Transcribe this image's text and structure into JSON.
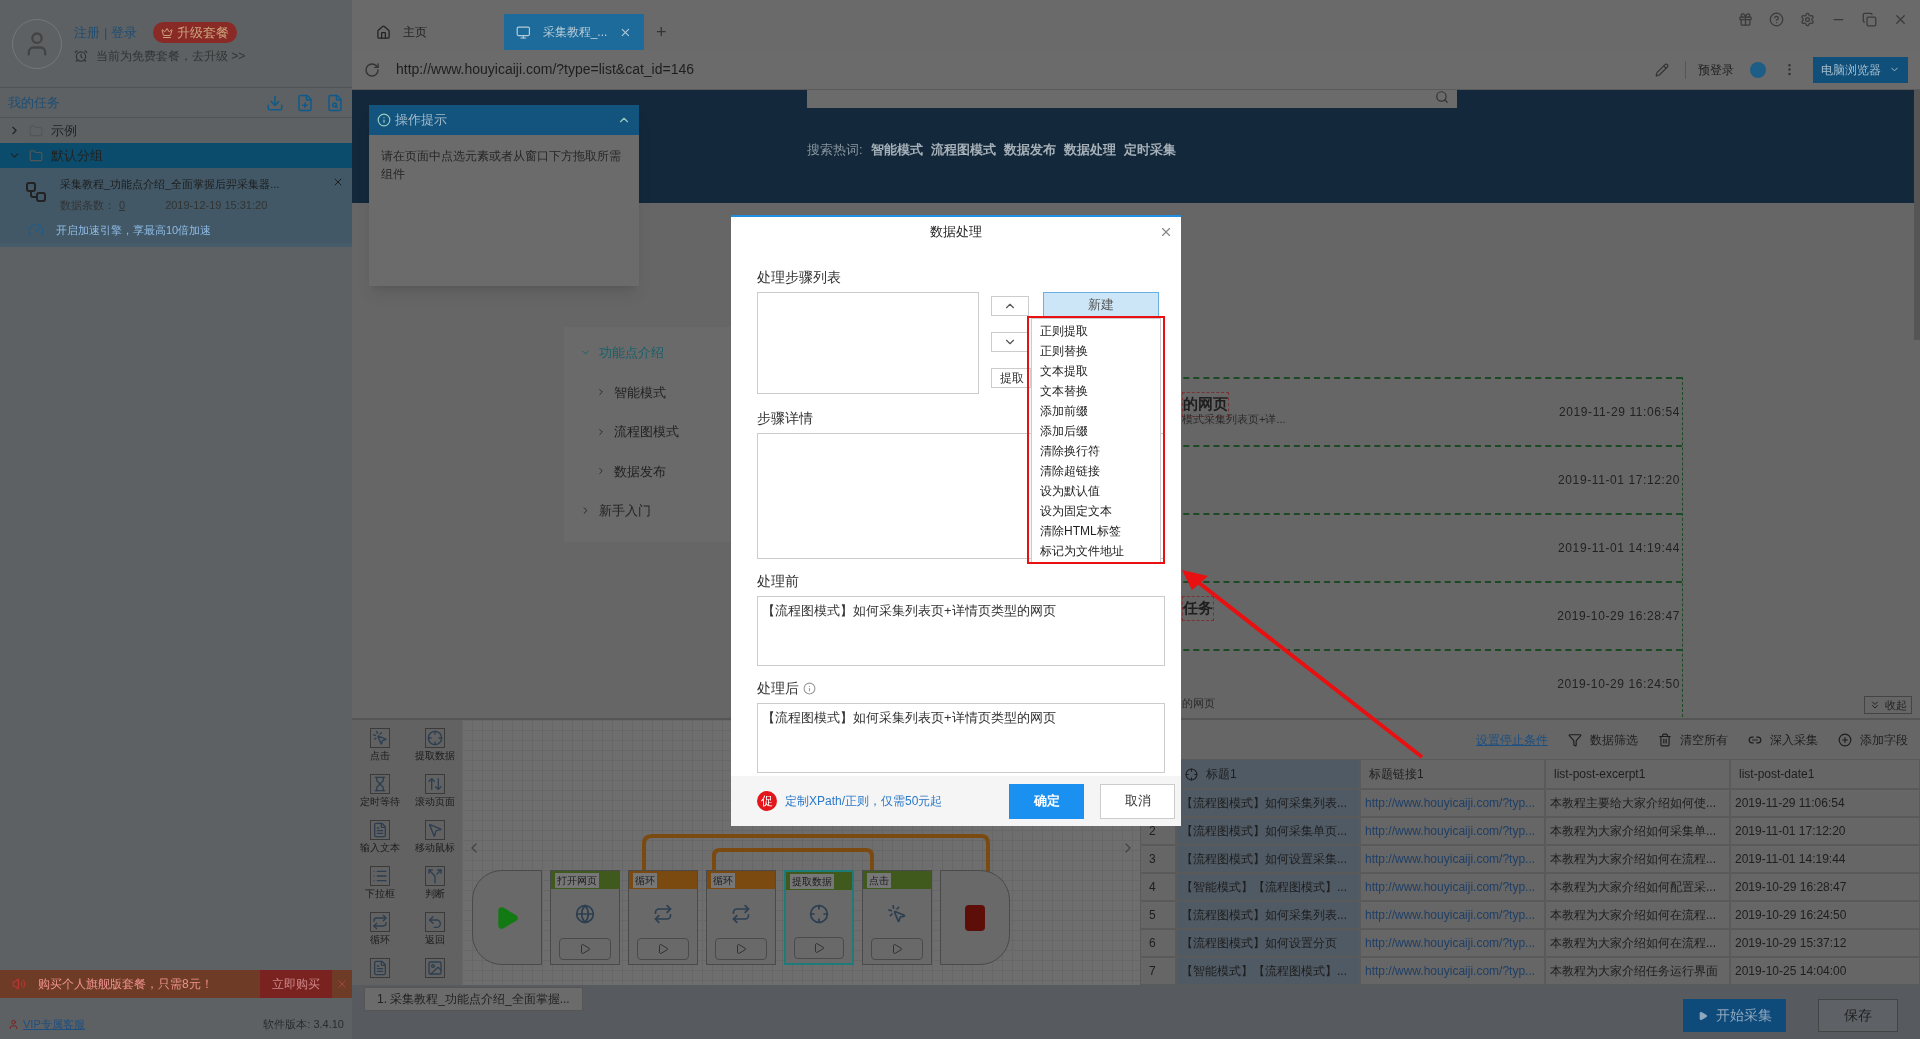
{
  "sidebar": {
    "account_links": [
      "注册",
      "登录"
    ],
    "link_separator": "|",
    "upgrade_badge": "升级套餐",
    "plan_notice": "当前为免费套餐，去升级 >>",
    "tasks_title": "我的任务",
    "groups": [
      {
        "label": "示例",
        "expanded": false,
        "selected": false
      },
      {
        "label": "默认分组",
        "expanded": true,
        "selected": true,
        "tasks": [
          {
            "name": "采集教程_功能点介绍_全面掌握后羿采集器...",
            "count_label": "数据条数：",
            "count": "0",
            "time": "2019-12-19 15:31:20"
          }
        ]
      }
    ],
    "accelerate_link": "开启加速引擎，享最高10倍加速",
    "promo": {
      "text": "购买个人旗舰版套餐，只需8元！",
      "button": "立即购买"
    },
    "vip_link": "VIP专属客服",
    "version": "软件版本: 3.4.10"
  },
  "browser": {
    "tabs": [
      {
        "kind": "home",
        "label": "主页",
        "selected": false
      },
      {
        "kind": "page",
        "label": "采集教程_...",
        "selected": true
      }
    ],
    "new_tab": "+",
    "url": "http://www.houyicaiji.com/?type=list&cat_id=146",
    "prelogin": "预登录",
    "browser_mode": "电脑浏览器"
  },
  "webpage": {
    "hot_label": "搜索热词:",
    "hot_words": [
      "智能模式",
      "流程图模式",
      "数据发布",
      "数据处理",
      "定时采集"
    ],
    "nav": [
      {
        "label": "功能点介绍",
        "expanded": true,
        "selected": true,
        "children": [
          {
            "label": "智能模式"
          },
          {
            "label": "流程图模式"
          },
          {
            "label": "数据发布"
          }
        ]
      },
      {
        "label": "新手入门",
        "expanded": false,
        "selected": false
      }
    ],
    "list_items": [
      {
        "title": "的网页",
        "excerpt": "模式采集列表页+详...",
        "date": "2019-11-29 11:06:54"
      },
      {
        "date": "2019-11-01 17:12:20"
      },
      {
        "date": "2019-11-01 14:19:44"
      },
      {
        "title": "任务",
        "date": "2019-10-29 16:28:47"
      },
      {
        "excerpt": "的网页",
        "date": "2019-10-29 16:24:50"
      }
    ],
    "collapse_button": "收起"
  },
  "tips": {
    "title": "操作提示",
    "body": "请在页面中点选元素或者从窗口下方拖取所需组件"
  },
  "dialog": {
    "title": "数据处理",
    "steps_label": "处理步骤列表",
    "new_button": "新建",
    "extract_button": "提取",
    "menu": [
      "正则提取",
      "正则替换",
      "文本提取",
      "文本替换",
      "添加前缀",
      "添加后缀",
      "清除换行符",
      "清除超链接",
      "设为默认值",
      "设为固定文本",
      "清除HTML标签",
      "标记为文件地址"
    ],
    "details_label": "步骤详情",
    "before_label": "处理前",
    "before_value": "【流程图模式】如何采集列表页+详情页类型的网页",
    "after_label": "处理后",
    "after_value": "【流程图模式】如何采集列表页+详情页类型的网页",
    "promo_badge": "促",
    "promo_link": "定制XPath/正则，仅需50元起",
    "ok": "确定",
    "cancel": "取消"
  },
  "workflow": {
    "tools": [
      {
        "kind": "click",
        "label": "点击"
      },
      {
        "kind": "extract",
        "label": "提取数据"
      },
      {
        "kind": "wait",
        "label": "定时等待"
      },
      {
        "kind": "scroll",
        "label": "滚动页面"
      },
      {
        "kind": "input",
        "label": "输入文本"
      },
      {
        "kind": "mouse",
        "label": "移动鼠标"
      },
      {
        "kind": "dropdown",
        "label": "下拉框"
      },
      {
        "kind": "judge",
        "label": "判断"
      },
      {
        "kind": "loop",
        "label": "循环"
      },
      {
        "kind": "back",
        "label": "返回"
      },
      {
        "kind": "input"
      },
      {
        "kind": "image"
      }
    ],
    "nodes": [
      {
        "kind": "open",
        "label": "打开网页",
        "selected": false
      },
      {
        "kind": "loop",
        "label": "循环",
        "selected": false
      },
      {
        "kind": "loop",
        "label": "循环",
        "selected": false
      },
      {
        "kind": "extract",
        "label": "提取数据",
        "selected": true
      },
      {
        "kind": "click",
        "label": "点击",
        "selected": false
      }
    ],
    "task_tab": "1. 采集教程_功能点介绍_全面掌握..."
  },
  "table": {
    "stop_link": "设置停止条件",
    "actions": [
      {
        "kind": "filter",
        "label": "数据筛选"
      },
      {
        "kind": "trash",
        "label": "清空所有"
      },
      {
        "kind": "link",
        "label": "深入采集"
      },
      {
        "kind": "add",
        "label": "添加字段"
      }
    ],
    "columns": [
      "标题1",
      "标题链接1",
      "list-post-excerpt1",
      "list-post-date1"
    ],
    "rows": [
      {
        "cells": [
          "【流程图模式】如何采集列表...",
          "http://www.houyicaiji.com/?typ...",
          "本教程主要给大家介绍如何使...",
          "2019-11-29 11:06:54"
        ]
      },
      {
        "index": "2",
        "cells": [
          "【流程图模式】如何采集单页...",
          "http://www.houyicaiji.com/?typ...",
          "本教程为大家介绍如何采集单...",
          "2019-11-01 17:12:20"
        ]
      },
      {
        "index": "3",
        "cells": [
          "【流程图模式】如何设置采集...",
          "http://www.houyicaiji.com/?typ...",
          "本教程为大家介绍如何在流程...",
          "2019-11-01 14:19:44"
        ]
      },
      {
        "index": "4",
        "cells": [
          "【智能模式】【流程图模式】...",
          "http://www.houyicaiji.com/?typ...",
          "本教程为大家介绍如何配置采...",
          "2019-10-29 16:28:47"
        ]
      },
      {
        "index": "5",
        "cells": [
          "【流程图模式】如何采集列表...",
          "http://www.houyicaiji.com/?typ...",
          "本教程为大家介绍如何在流程...",
          "2019-10-29 16:24:50"
        ]
      },
      {
        "index": "6",
        "cells": [
          "【流程图模式】如何设置分页",
          "http://www.houyicaiji.com/?typ...",
          "本教程为大家介绍如何在流程...",
          "2019-10-29 15:37:12"
        ]
      },
      {
        "index": "7",
        "cells": [
          "【智能模式】【流程图模式】...",
          "http://www.houyicaiji.com/?typ...",
          "本教程为大家介绍任务运行界面",
          "2019-10-25 14:04:00"
        ]
      }
    ]
  },
  "footer": {
    "start_button": "开始采集",
    "save_button": "保存"
  }
}
